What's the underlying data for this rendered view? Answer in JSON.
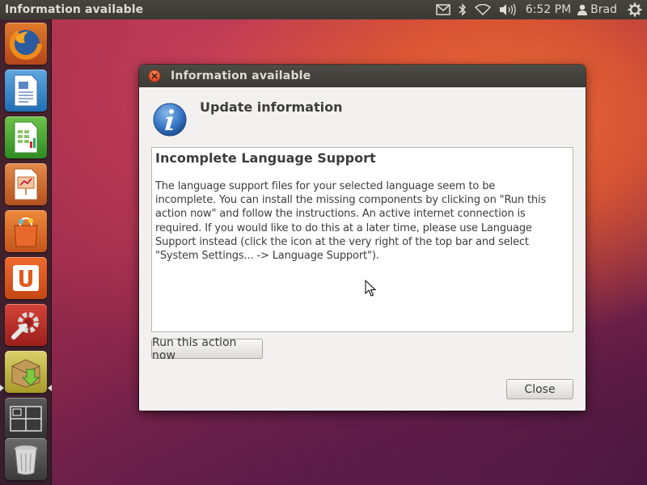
{
  "top_panel": {
    "app_title": "Information available",
    "clock": "6:52 PM",
    "user": "Brad",
    "indicators": [
      "mail-icon",
      "bluetooth-icon",
      "wifi-icon",
      "volume-icon",
      "gear-icon"
    ]
  },
  "launcher": {
    "items": [
      {
        "name": "firefox",
        "icon": "firefox-icon"
      },
      {
        "name": "libreoffice-writer",
        "icon": "writer-icon"
      },
      {
        "name": "libreoffice-calc",
        "icon": "calc-icon"
      },
      {
        "name": "libreoffice-impress",
        "icon": "impress-icon"
      },
      {
        "name": "ubuntu-software-center",
        "icon": "software-center-icon"
      },
      {
        "name": "ubuntu-one",
        "icon": "ubuntu-one-icon"
      },
      {
        "name": "system-settings",
        "icon": "settings-icon"
      },
      {
        "name": "update-manager",
        "icon": "update-icon",
        "active": true
      },
      {
        "name": "workspace-switcher",
        "icon": "workspaces-icon"
      },
      {
        "name": "trash",
        "icon": "trash-icon"
      }
    ]
  },
  "dialog": {
    "title": "Information available",
    "heading": "Update information",
    "content_title": "Incomplete Language Support",
    "content_body": "The language support files for your selected language seem to be\nincomplete. You can install the missing components by clicking on \"Run this\naction now\" and follow the instructions. An active internet connection is\nrequired. If you would like to do this at a later time, please use Language\nSupport instead (click the icon at the very right of the top bar and select\n\"System Settings... -> Language Support\").",
    "run_button": "Run this action now",
    "close_button": "Close"
  },
  "colors": {
    "panel": "#3c3b37",
    "panel_text": "#dfdbd2",
    "dialog_bg": "#f2f1f0",
    "close_dot": "#e0502a"
  }
}
